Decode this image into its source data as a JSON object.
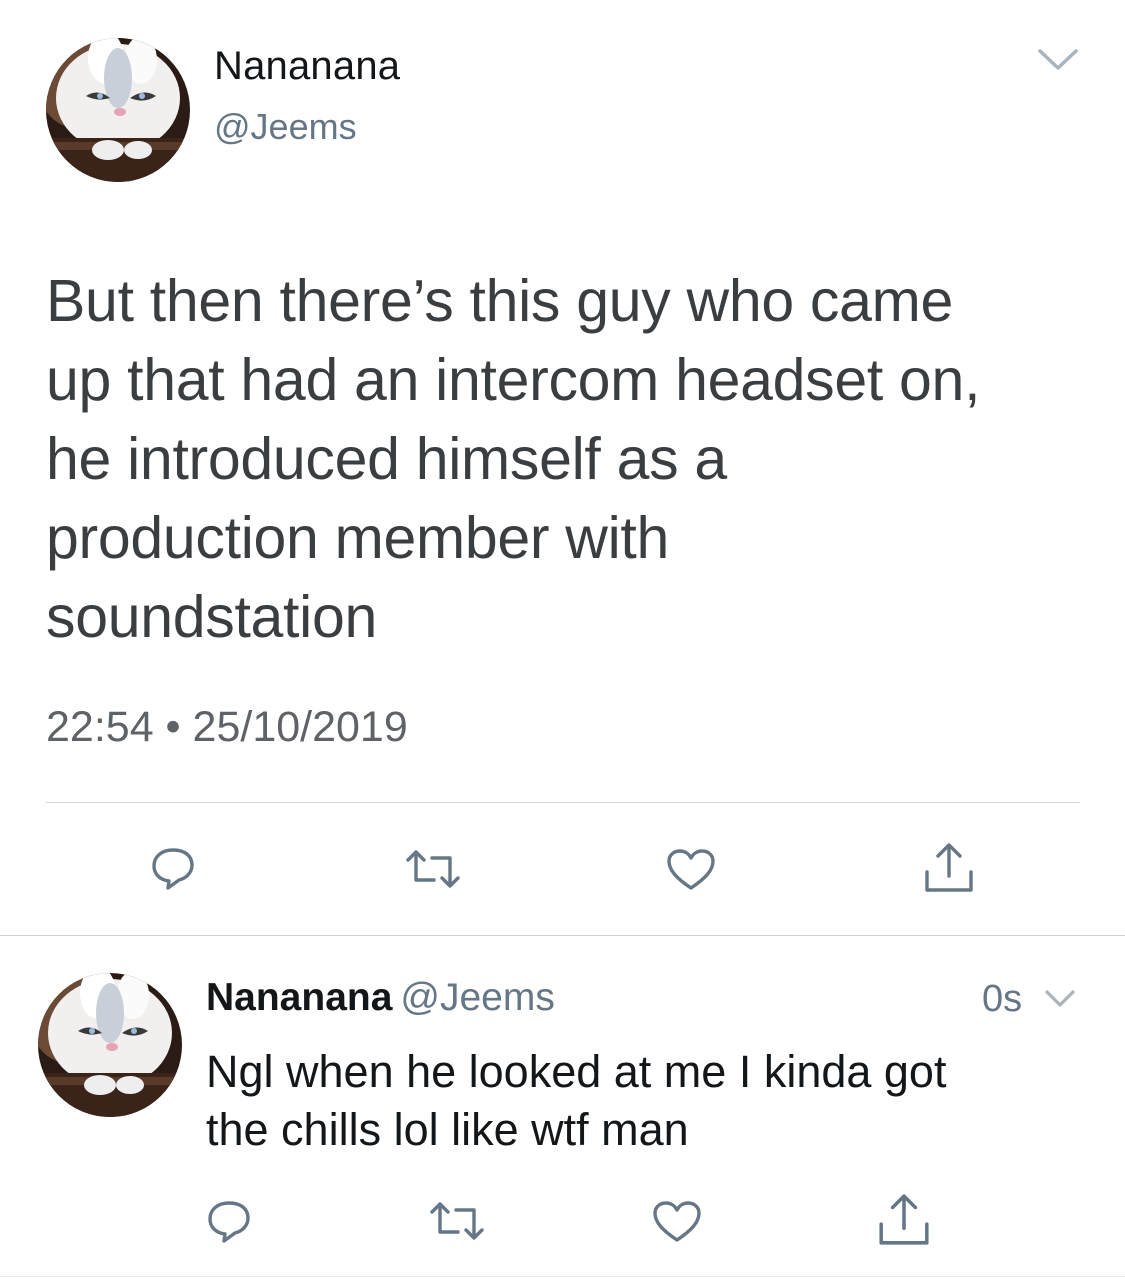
{
  "main_tweet": {
    "display_name": "Nananana",
    "handle": "@Jeems",
    "text_lines": [
      "But then there’s this guy who came",
      "up that had an intercom headset on,",
      "he introduced himself as a",
      "production member with",
      "soundstation"
    ],
    "timestamp": "22:54 • 25/10/2019",
    "actions": [
      "reply-icon",
      "retweet-icon",
      "like-icon",
      "share-icon"
    ]
  },
  "reply_tweet": {
    "display_name": "Nananana",
    "handle": "@Jeems",
    "time": "0s",
    "text_lines": [
      "Ngl when he looked at me I kinda got",
      "the chills lol like wtf man"
    ],
    "actions": [
      "reply-icon",
      "retweet-icon",
      "like-icon",
      "share-icon"
    ]
  },
  "colors": {
    "text_primary": "#14171a",
    "text_secondary": "#657786",
    "icon": "#657786",
    "divider": "#d9d9d9"
  }
}
